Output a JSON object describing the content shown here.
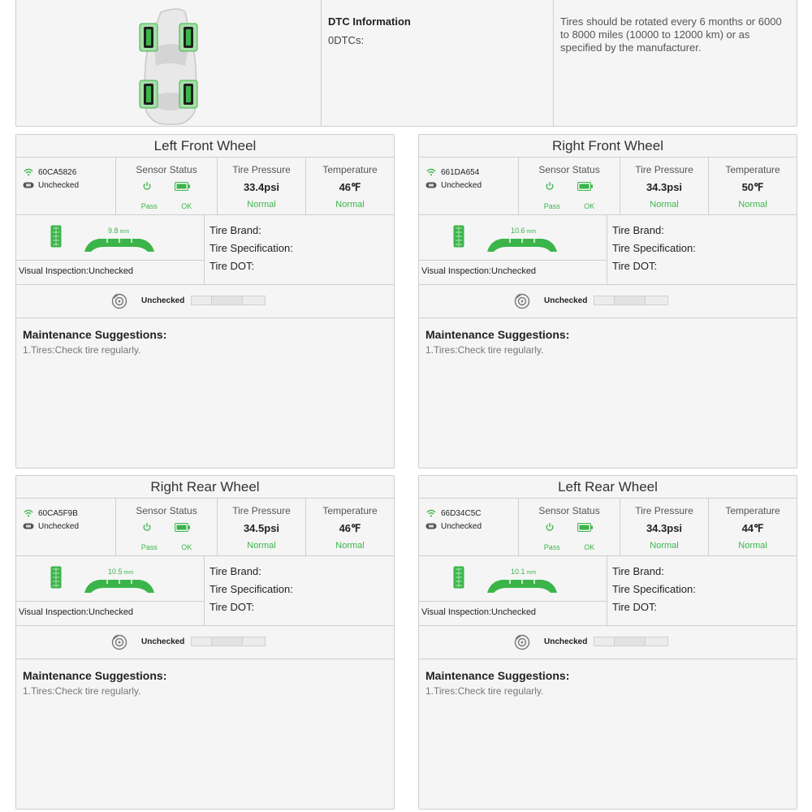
{
  "summary": {
    "dtc_title": "DTC Information",
    "dtc_count": "0DTCs:",
    "rotation_note": "Tires should be rotated every 6 months or 6000 to 8000 miles (10000 to 12000 km) or as specified by the manufacturer."
  },
  "labels": {
    "sensor_status": "Sensor Status",
    "tire_pressure": "Tire Pressure",
    "temperature": "Temperature",
    "tire_brand": "Tire Brand:",
    "tire_spec": "Tire Specification:",
    "tire_dot": "Tire DOT:",
    "maint_title": "Maintenance Suggestions:"
  },
  "colors": {
    "accent": "#3bb54a",
    "panel": "#f5f5f5",
    "border": "#cfcfcf"
  },
  "wheels": [
    {
      "title": "Left Front Wheel",
      "sensor_id": "60CA5826",
      "sensor_check": "Unchecked",
      "sensor_pass": "Pass",
      "battery_ok": "OK",
      "pressure": "33.4psi",
      "pressure_status": "Normal",
      "temperature": "46℉",
      "temperature_status": "Normal",
      "tread_depth": "9.8",
      "tread_unit": "mm",
      "visual_inspection": "Visual Inspection:Unchecked",
      "brake_status": "Unchecked",
      "maint_item": "1.Tires:Check tire regularly."
    },
    {
      "title": "Right Front Wheel",
      "sensor_id": "661DA654",
      "sensor_check": "Unchecked",
      "sensor_pass": "Pass",
      "battery_ok": "OK",
      "pressure": "34.3psi",
      "pressure_status": "Normal",
      "temperature": "50℉",
      "temperature_status": "Normal",
      "tread_depth": "10.6",
      "tread_unit": "mm",
      "visual_inspection": "Visual Inspection:Unchecked",
      "brake_status": "Unchecked",
      "maint_item": "1.Tires:Check tire regularly."
    },
    {
      "title": "Right Rear Wheel",
      "sensor_id": "60CA5F9B",
      "sensor_check": "Unchecked",
      "sensor_pass": "Pass",
      "battery_ok": "OK",
      "pressure": "34.5psi",
      "pressure_status": "Normal",
      "temperature": "46℉",
      "temperature_status": "Normal",
      "tread_depth": "10.5",
      "tread_unit": "mm",
      "visual_inspection": "Visual Inspection:Unchecked",
      "brake_status": "Unchecked",
      "maint_item": "1.Tires:Check tire regularly."
    },
    {
      "title": "Left Rear Wheel",
      "sensor_id": "66D34C5C",
      "sensor_check": "Unchecked",
      "sensor_pass": "Pass",
      "battery_ok": "OK",
      "pressure": "34.3psi",
      "pressure_status": "Normal",
      "temperature": "44℉",
      "temperature_status": "Normal",
      "tread_depth": "10.1",
      "tread_unit": "mm",
      "visual_inspection": "Visual Inspection:Unchecked",
      "brake_status": "Unchecked",
      "maint_item": "1.Tires:Check tire regularly."
    }
  ]
}
